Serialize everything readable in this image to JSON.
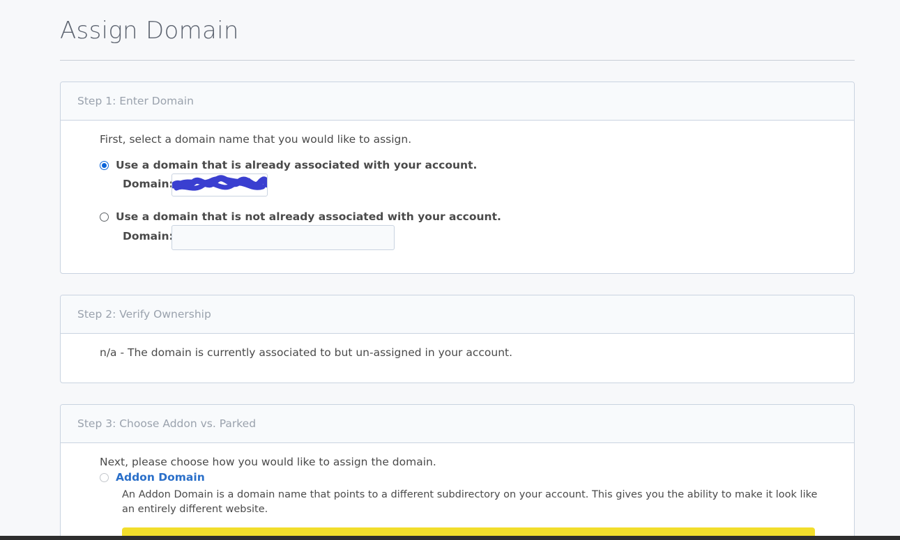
{
  "page": {
    "title": "Assign Domain"
  },
  "step1": {
    "heading": "Step 1: Enter Domain",
    "intro": "First, select a domain name that you would like to assign.",
    "option_existing": {
      "label": "Use a domain that is already associated with your account.",
      "selected": true,
      "domain_label": "Domain:",
      "domain_value_redacted": true
    },
    "option_new": {
      "label": "Use a domain that is not already associated with your account.",
      "selected": false,
      "domain_label": "Domain:",
      "domain_value": ""
    }
  },
  "step2": {
    "heading": "Step 2: Verify Ownership",
    "message": "n/a - The domain is currently associated to but un-assigned in your account."
  },
  "step3": {
    "heading": "Step 3: Choose Addon vs. Parked",
    "intro": "Next, please choose how you would like to assign the domain.",
    "addon": {
      "label": "Addon Domain",
      "selected": false,
      "description": "An Addon Domain is a domain name that points to a different subdirectory on your account. This gives you the ability to make it look like an entirely different website."
    }
  },
  "colors": {
    "accent": "#0b63d8",
    "link": "#2a6fc9",
    "warning_bar": "#f2de2c",
    "redaction": "#3a3fd0"
  }
}
